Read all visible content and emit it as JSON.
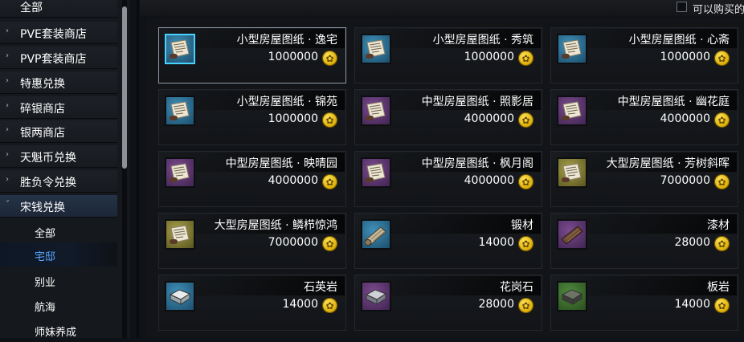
{
  "sidebar": {
    "items": [
      {
        "label": "全部",
        "chevron": "none"
      },
      {
        "label": "PVE套装商店",
        "chevron": "right"
      },
      {
        "label": "PVP套装商店",
        "chevron": "right"
      },
      {
        "label": "特惠兑换",
        "chevron": "right"
      },
      {
        "label": "碎银商店",
        "chevron": "right"
      },
      {
        "label": "银两商店",
        "chevron": "right"
      },
      {
        "label": "天魁币兑换",
        "chevron": "right"
      },
      {
        "label": "胜负令兑换",
        "chevron": "right"
      },
      {
        "label": "宋钱兑换",
        "chevron": "down"
      }
    ],
    "subitems": [
      {
        "label": "全部"
      },
      {
        "label": "宅邸"
      },
      {
        "label": "别业"
      },
      {
        "label": "航海"
      },
      {
        "label": "师妹养成"
      }
    ],
    "chevron_right_glyph": "›",
    "chevron_down_glyph": "˅"
  },
  "topbar": {
    "filter_label": "可以购买的"
  },
  "currency_icon": "gold-coin-icon",
  "coin_glyph": "✿",
  "products": [
    {
      "name": "小型房屋图纸 · 逸宅",
      "price": "1000000",
      "icon": "blueprint-scroll-icon",
      "color": "blue"
    },
    {
      "name": "小型房屋图纸 · 秀筑",
      "price": "1000000",
      "icon": "blueprint-scroll-icon",
      "color": "blue"
    },
    {
      "name": "小型房屋图纸 · 心斋",
      "price": "1000000",
      "icon": "blueprint-scroll-icon",
      "color": "blue"
    },
    {
      "name": "小型房屋图纸 · 锦苑",
      "price": "1000000",
      "icon": "blueprint-scroll-icon",
      "color": "blue"
    },
    {
      "name": "中型房屋图纸 · 照影居",
      "price": "4000000",
      "icon": "blueprint-scroll-icon",
      "color": "purple"
    },
    {
      "name": "中型房屋图纸 · 幽花庭",
      "price": "4000000",
      "icon": "blueprint-scroll-icon",
      "color": "purple"
    },
    {
      "name": "中型房屋图纸 · 映晴园",
      "price": "4000000",
      "icon": "blueprint-scroll-icon",
      "color": "purple"
    },
    {
      "name": "中型房屋图纸 · 枫月阁",
      "price": "4000000",
      "icon": "blueprint-scroll-icon",
      "color": "purple"
    },
    {
      "name": "大型房屋图纸 · 芳树斜晖",
      "price": "7000000",
      "icon": "blueprint-scroll-icon",
      "color": "gold"
    },
    {
      "name": "大型房屋图纸 · 鳞栉惊鸿",
      "price": "7000000",
      "icon": "blueprint-scroll-icon",
      "color": "gold"
    },
    {
      "name": "锻材",
      "price": "14000",
      "icon": "timber-log-icon",
      "color": "blue"
    },
    {
      "name": "漆材",
      "price": "28000",
      "icon": "lacquer-wood-icon",
      "color": "purple"
    },
    {
      "name": "石英岩",
      "price": "14000",
      "icon": "stone-block-icon",
      "color": "blue"
    },
    {
      "name": "花岗石",
      "price": "28000",
      "icon": "stone-block-icon",
      "color": "purple"
    },
    {
      "name": "板岩",
      "price": "14000",
      "icon": "stone-block-icon",
      "color": "green"
    }
  ]
}
